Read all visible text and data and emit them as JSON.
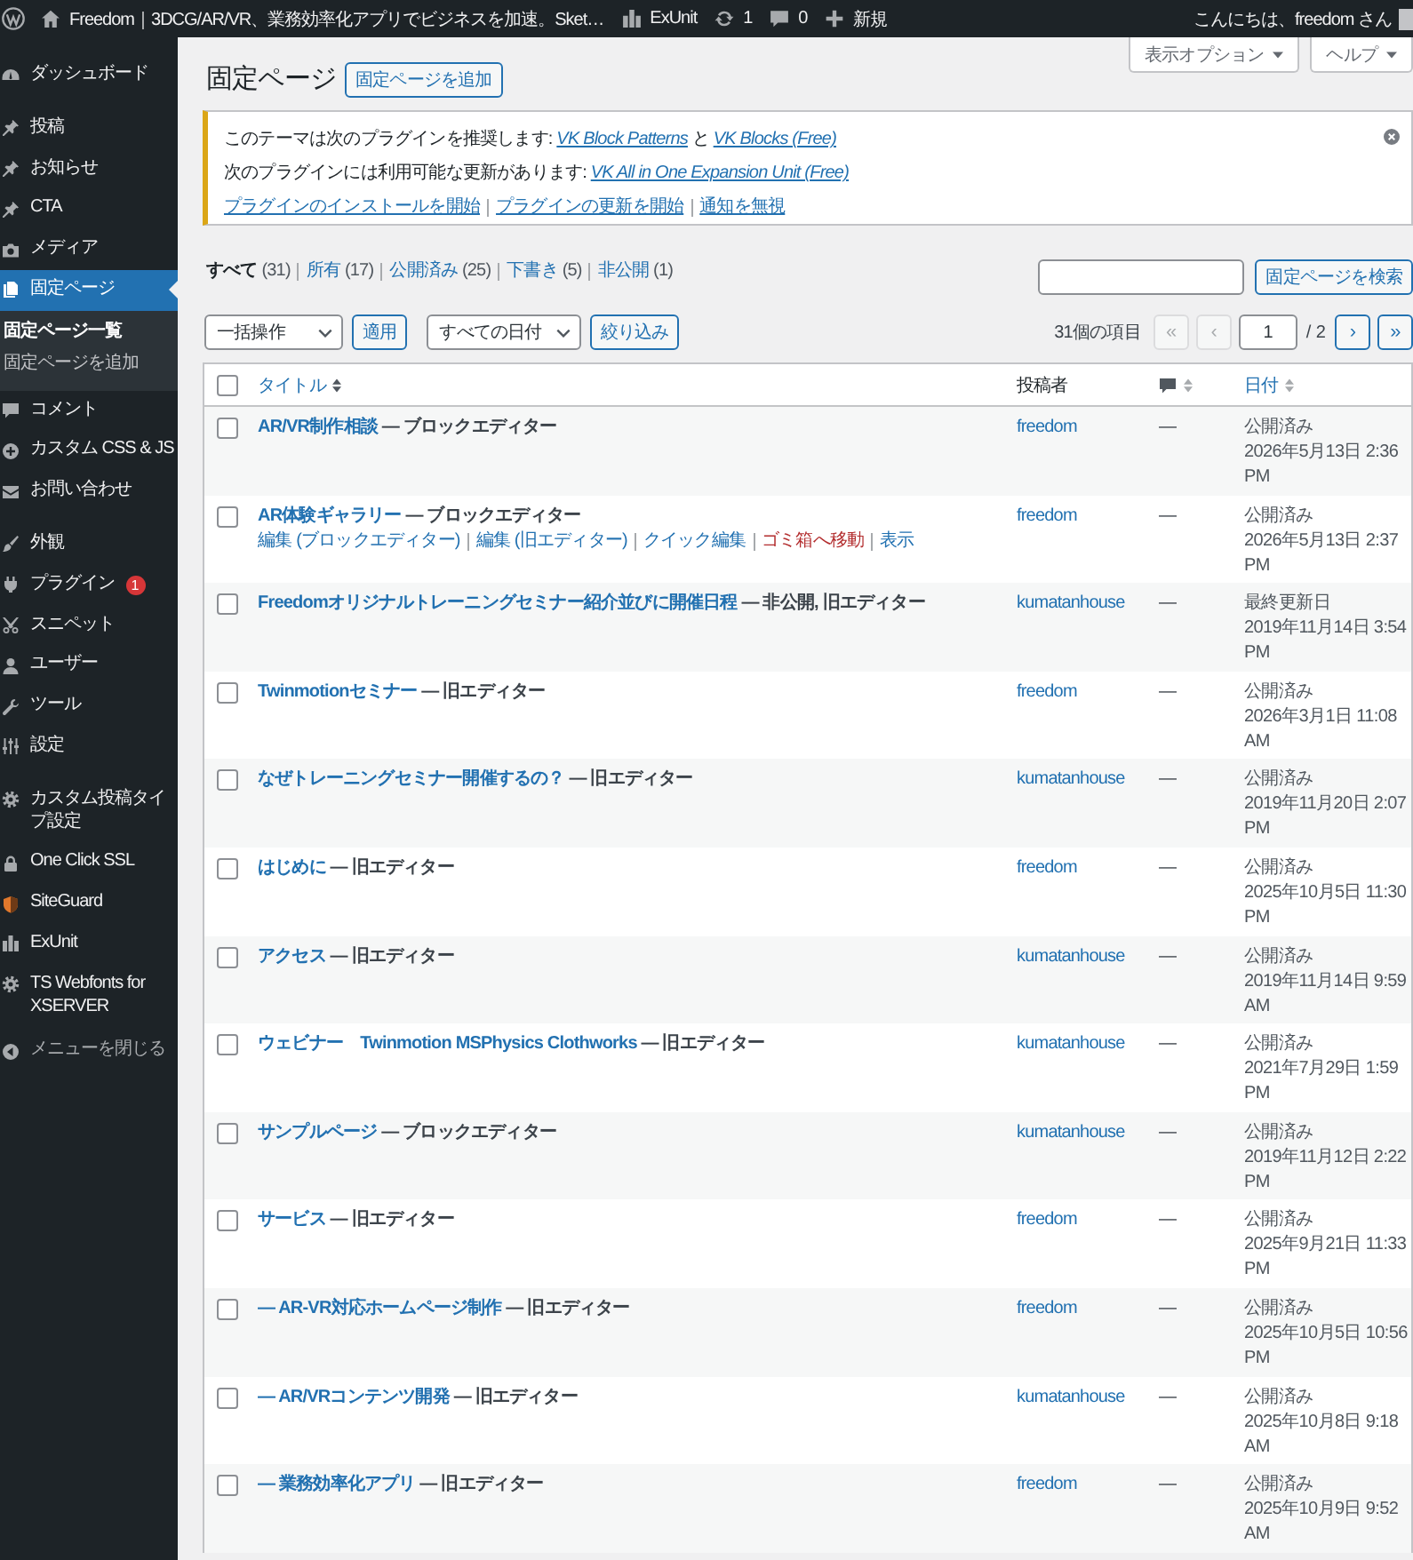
{
  "admin_bar": {
    "site_name": "Freedom｜3DCG/AR/VR、業務効率化アプリでビジネスを加速。Sket…",
    "exunit": "ExUnit",
    "updates": "1",
    "comments": "0",
    "new_content": "新規",
    "greeting": "こんにちは、freedom さん"
  },
  "sidebar": {
    "groups": [
      {
        "items": [
          {
            "label": "ダッシュボード",
            "selected": false
          }
        ]
      },
      {
        "items": [
          {
            "label": "投稿",
            "selected": false
          },
          {
            "label": "お知らせ",
            "selected": false
          },
          {
            "label": "CTA",
            "selected": false
          },
          {
            "label": "メディア",
            "selected": false
          },
          {
            "label": "固定ページ",
            "selected": true,
            "submenu": [
              {
                "label": "固定ページ一覧",
                "selected": true
              },
              {
                "label": "固定ページを追加",
                "selected": false
              }
            ]
          },
          {
            "label": "コメント",
            "selected": false
          },
          {
            "label": "カスタム CSS & JS",
            "selected": false
          },
          {
            "label": "お問い合わせ",
            "selected": false
          }
        ]
      },
      {
        "items": [
          {
            "label": "外観",
            "selected": false
          },
          {
            "label": "プラグイン",
            "selected": false,
            "badge": "1"
          },
          {
            "label": "スニペット",
            "selected": false
          },
          {
            "label": "ユーザー",
            "selected": false
          },
          {
            "label": "ツール",
            "selected": false
          },
          {
            "label": "設定",
            "selected": false
          }
        ]
      },
      {
        "items": [
          {
            "label": "カスタム投稿タイプ設定",
            "selected": false
          },
          {
            "label": "One Click SSL",
            "selected": false
          },
          {
            "label": "SiteGuard",
            "selected": false
          },
          {
            "label": "ExUnit",
            "selected": false
          },
          {
            "label": "TS Webfonts for XSERVER",
            "selected": false
          }
        ]
      }
    ],
    "collapse": "メニューを閉じる"
  },
  "screen_meta": [
    {
      "label": "表示オプション"
    },
    {
      "label": "ヘルプ"
    }
  ],
  "page_title": "固定ページ",
  "add_new": "固定ページを追加",
  "notice": {
    "lines": [
      {
        "parts": [
          {
            "kind": "text",
            "text": "このテーマは次のプラグインを推奨します: "
          },
          {
            "kind": "link",
            "text": "VK Block Patterns"
          },
          {
            "kind": "text",
            "text": " と "
          },
          {
            "kind": "link",
            "text": "VK Blocks (Free)"
          }
        ]
      },
      {
        "parts": [
          {
            "kind": "text",
            "text": "次のプラグインには利用可能な更新があります: "
          },
          {
            "kind": "link",
            "text": "VK All in One Expansion Unit (Free)"
          }
        ]
      }
    ],
    "actions": [
      "プラグインのインストールを開始",
      "プラグインの更新を開始",
      "通知を無視"
    ]
  },
  "views": [
    {
      "label": "すべて",
      "count": "(31)",
      "selected": true
    },
    {
      "label": "所有",
      "count": "(17)",
      "selected": false
    },
    {
      "label": "公開済み",
      "count": "(25)",
      "selected": false
    },
    {
      "label": "下書き",
      "count": "(5)",
      "selected": false
    },
    {
      "label": "非公開",
      "count": "(1)",
      "selected": false
    }
  ],
  "search": {
    "button": "固定ページを検索"
  },
  "bulk_actions": {
    "select": "一括操作",
    "apply": "適用"
  },
  "date_filter": {
    "select": "すべての日付",
    "button": "絞り込み"
  },
  "pagination": {
    "count": "31個の項目",
    "prev": [
      {
        "label": "«",
        "disabled": true
      },
      {
        "label": "‹",
        "disabled": true
      }
    ],
    "current": "1",
    "total": "/ 2",
    "next": [
      {
        "label": "›",
        "disabled": false
      },
      {
        "label": "»",
        "disabled": false
      }
    ]
  },
  "table": {
    "select_all": {
      "checked": false
    },
    "columns": [
      {
        "kind": "text",
        "label": "タイトル",
        "sortable": true,
        "sorted": true
      },
      {
        "kind": "text",
        "label": "投稿者",
        "sortable": false
      },
      {
        "kind": "comments",
        "sortable": true,
        "sorted": false
      },
      {
        "kind": "text",
        "label": "日付",
        "sortable": true,
        "sorted": false
      }
    ],
    "rows": [
      {
        "checked": false,
        "title": "AR/VR制作相談",
        "state": "— ブロックエディター",
        "author": "freedom",
        "comments": "—",
        "status": "公開済み",
        "date": "2026年5月13日 2:36 PM"
      },
      {
        "checked": false,
        "title": "AR体験ギャラリー",
        "state": "— ブロックエディター",
        "actions": [
          {
            "kind": "link",
            "label": "編集 (ブロックエディター)"
          },
          {
            "kind": "link",
            "label": "編集 (旧エディター)"
          },
          {
            "kind": "link",
            "label": "クイック編集"
          },
          {
            "kind": "delete",
            "label": "ゴミ箱へ移動"
          },
          {
            "kind": "link",
            "label": "表示"
          }
        ],
        "author": "freedom",
        "comments": "—",
        "status": "公開済み",
        "date": "2026年5月13日 2:37 PM"
      },
      {
        "checked": false,
        "title": "Freedomオリジナルトレーニングセミナー紹介並びに開催日程",
        "state": "— 非公開, 旧エディター",
        "author": "kumatanhouse",
        "comments": "—",
        "status": "最終更新日",
        "date": "2019年11月14日 3:54 PM"
      },
      {
        "checked": false,
        "title": "Twinmotionセミナー",
        "state": "— 旧エディター",
        "author": "freedom",
        "comments": "—",
        "status": "公開済み",
        "date": "2026年3月1日 11:08 AM"
      },
      {
        "checked": false,
        "title": "なぜトレーニングセミナー開催するの？",
        "state": "— 旧エディター",
        "author": "kumatanhouse",
        "comments": "—",
        "status": "公開済み",
        "date": "2019年11月20日 2:07 PM"
      },
      {
        "checked": false,
        "title": "はじめに",
        "state": "— 旧エディター",
        "author": "freedom",
        "comments": "—",
        "status": "公開済み",
        "date": "2025年10月5日 11:30 PM"
      },
      {
        "checked": false,
        "title": "アクセス",
        "state": "— 旧エディター",
        "author": "kumatanhouse",
        "comments": "—",
        "status": "公開済み",
        "date": "2019年11月14日 9:59 AM"
      },
      {
        "checked": false,
        "title": "ウェビナー　Twinmotion MSPhysics Clothworks",
        "state": "— 旧エディター",
        "author": "kumatanhouse",
        "comments": "—",
        "status": "公開済み",
        "date": "2021年7月29日 1:59 PM"
      },
      {
        "checked": false,
        "title": "サンプルページ",
        "state": "— ブロックエディター",
        "author": "kumatanhouse",
        "comments": "—",
        "status": "公開済み",
        "date": "2019年11月12日 2:22 PM"
      },
      {
        "checked": false,
        "title": "サービス",
        "state": "— 旧エディター",
        "author": "freedom",
        "comments": "—",
        "status": "公開済み",
        "date": "2025年9月21日 11:33 PM"
      },
      {
        "checked": false,
        "title": "— AR-VR対応ホームページ制作",
        "state": "— 旧エディター",
        "author": "freedom",
        "comments": "—",
        "status": "公開済み",
        "date": "2025年10月5日 10:56 PM"
      },
      {
        "checked": false,
        "title": "— AR/VRコンテンツ開発",
        "state": "— 旧エディター",
        "author": "kumatanhouse",
        "comments": "—",
        "status": "公開済み",
        "date": "2025年10月8日 9:18 AM"
      },
      {
        "checked": false,
        "title": "— 業務効率化アプリ",
        "state": "— 旧エディター",
        "author": "freedom",
        "comments": "—",
        "status": "公開済み",
        "date": "2025年10月9日 9:52 AM"
      }
    ]
  }
}
